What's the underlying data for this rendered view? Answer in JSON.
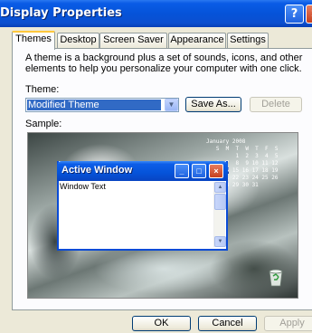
{
  "window": {
    "title": "Display Properties",
    "help_button": "?",
    "close_button": "×"
  },
  "tabs": [
    {
      "label": "Themes",
      "active": true
    },
    {
      "label": "Desktop",
      "active": false
    },
    {
      "label": "Screen Saver",
      "active": false
    },
    {
      "label": "Appearance",
      "active": false
    },
    {
      "label": "Settings",
      "active": false
    }
  ],
  "themes": {
    "description": "A theme is a background plus a set of sounds, icons, and other elements to help you personalize your computer with one click.",
    "theme_label": "Theme:",
    "theme_value": "Modified Theme",
    "save_as_label": "Save As...",
    "delete_label": "Delete",
    "sample_label": "Sample:"
  },
  "sample": {
    "active_window_title": "Active Window",
    "window_text": "Window Text",
    "calendar_header": "January 2008",
    "calendar_highlight": "14"
  },
  "footer": {
    "ok_label": "OK",
    "cancel_label": "Cancel",
    "apply_label": "Apply"
  },
  "colors": {
    "titlebar": "#0553d9",
    "selection": "#316ac5",
    "tab_highlight": "#ffc83c",
    "dialog_bg": "#ece9d8"
  }
}
